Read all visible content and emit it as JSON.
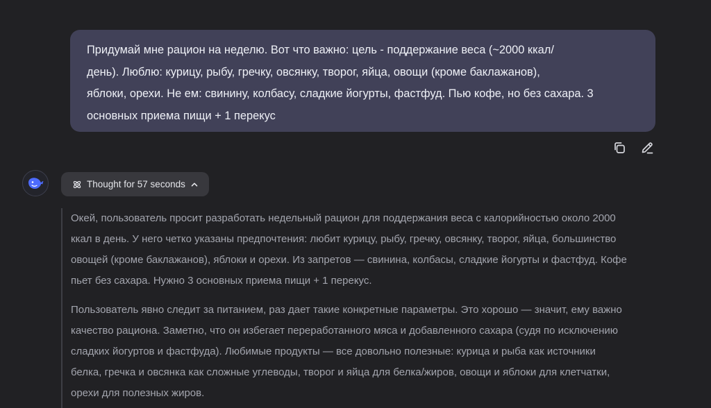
{
  "user_message": {
    "lines": [
      "Придумай мне рацион на неделю. Вот что важно: цель - поддержание веса (~2000 ккал/",
      "день). Люблю: курицу, рыбу, гречку, овсянку, творог, яйца, овощи (кроме баклажанов),",
      "яблоки, орехи. Не ем: свинину, колбасу, сладкие йогурты, фастфуд. Пью кофе, но без сахара. 3",
      "основных приема пищи + 1 перекус"
    ]
  },
  "message_actions": {
    "copy_icon": "copy-icon",
    "edit_icon": "pencil-icon"
  },
  "assistant": {
    "avatar_icon": "whale-icon",
    "thought_label": "Thought for 57 seconds",
    "thought_paragraphs": [
      {
        "lines": [
          "Окей, пользователь просит разработать недельный рацион для поддержания веса с калорийностью около 2000",
          "ккал в день. У него четко указаны предпочтения: любит курицу, рыбу, гречку, овсянку, творог, яйца, большинство",
          "овощей (кроме баклажанов), яблоки и орехи. Из запретов — свинина, колбасы, сладкие йогурты и фастфуд. Кофе",
          "пьет без сахара. Нужно 3 основных приема пищи + 1 перекус."
        ]
      },
      {
        "lines": [
          "Пользователь явно следит за питанием, раз дает такие конкретные параметры. Это хорошо — значит, ему важно",
          "качество рациона. Заметно, что он избегает переработанного мяса и добавленного сахара (судя по исключению",
          "сладких йогуртов и фастфуда). Любимые продукты — все довольно полезные: курица и рыба как источники",
          "белка, гречка и овсянка как сложные углеводы, творог и яйца для белка/жиров, овощи и яблоки для клетчатки,",
          "орехи для полезных жиров."
        ]
      }
    ]
  },
  "colors": {
    "background": "#212124",
    "user_bubble": "#414158",
    "thought_button": "#38383d",
    "accent": "#4d6bfe"
  }
}
